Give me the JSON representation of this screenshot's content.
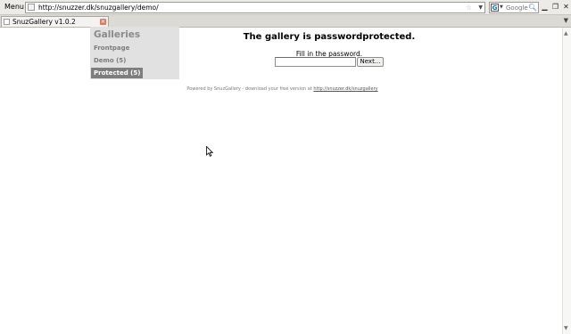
{
  "browser": {
    "menu_label": "Menu",
    "url": "http://snuzzer.dk/snuzgallery/demo/",
    "search_placeholder": "Google",
    "tab_title": "SnuzGallery v1.0.2"
  },
  "icons": {
    "star": "star-icon",
    "search": "magnifier-icon",
    "close": "close-icon",
    "minimize": "minimize-icon",
    "restore": "restore-icon"
  },
  "sidebar": {
    "title": "Galleries",
    "items": [
      {
        "label": "Frontpage",
        "active": false
      },
      {
        "label": "Demo (5)",
        "active": false
      },
      {
        "label": "Protected (5)",
        "active": true
      }
    ]
  },
  "main": {
    "heading": "The gallery is passwordprotected.",
    "password_label": "Fill in the password.",
    "password_value": "",
    "next_button": "Next..."
  },
  "footer": {
    "text": "Powered by SnuzGallery - download your free version at",
    "link": "http://snuzzer.dk/snuzgallery"
  },
  "colors": {
    "sidebar_bg": "#e1e1e1",
    "sidebar_active": "#7e7e7e",
    "sidebar_text": "#7c7c7c"
  }
}
